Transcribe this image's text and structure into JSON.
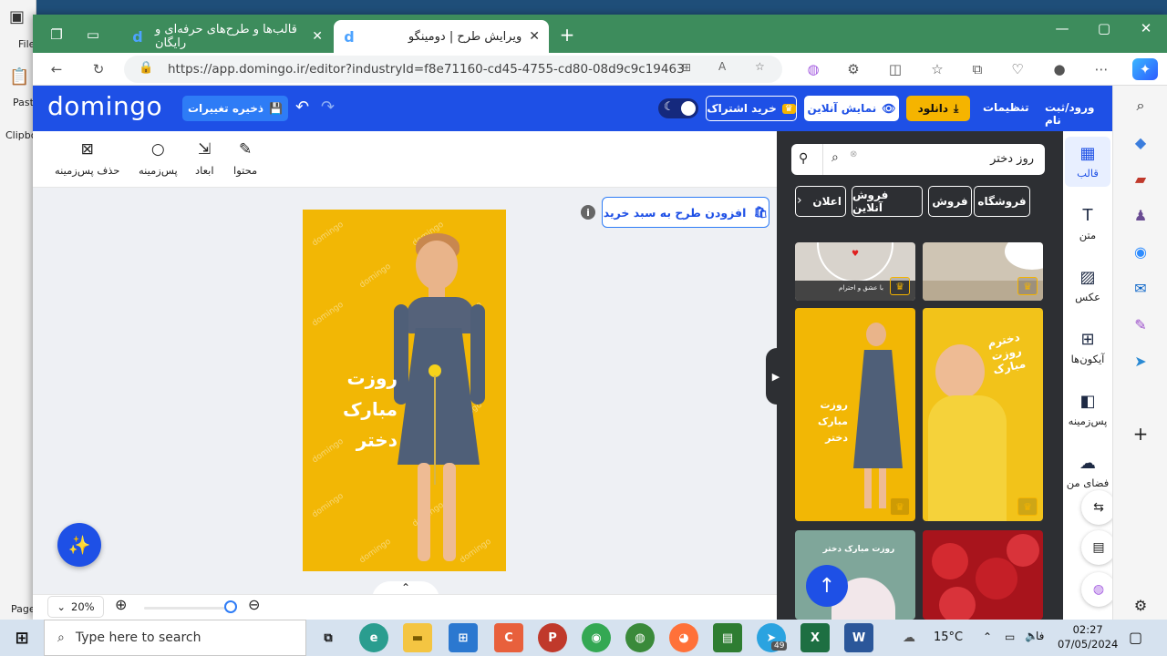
{
  "background_app": {
    "labels": [
      "File",
      "Paste",
      "Clipbo",
      "Page"
    ]
  },
  "browser": {
    "tabs": [
      {
        "label": "قالب‌ها و طرح‌های حرفه‌ای و رایگان"
      },
      {
        "label": "ویرایش طرح | دومینگو"
      }
    ],
    "url": "https://app.domingo.ir/editor?industryId=f8e71160-cd45-4755-cd80-08d9c9c19463"
  },
  "app": {
    "logo": "domingo",
    "save_label": "ذخیره تغییرات",
    "subscribe_label": "خرید اشتراک",
    "live_label": "نمایش آنلاین",
    "download_label": "دانلود",
    "settings_label": "تنظیمات",
    "login_label": "ورود/ثبت نام",
    "tools": [
      {
        "label": "حذف پس‌زمینه",
        "icon": "remove-bg-icon"
      },
      {
        "label": "پس‌زمینه",
        "icon": "background-circle-icon"
      },
      {
        "label": "ابعاد",
        "icon": "resize-icon"
      },
      {
        "label": "محتوا",
        "icon": "edit-pencil-icon"
      }
    ],
    "add_to_cart_label": "افزودن طرح به سبد خرید",
    "design": {
      "watermark": "domingo",
      "headline_line1": "روزت مبارک",
      "headline_line2": "دختر"
    },
    "zoom": "20%",
    "zoom_level_fraction": 0.9,
    "search_value": "روز دختر",
    "chips": [
      "فروشگاه",
      "فروش",
      "فروش آنلاین",
      "اعلان"
    ],
    "categories": [
      {
        "label": "قالب",
        "icon": "template-icon"
      },
      {
        "label": "متن",
        "icon": "text-icon"
      },
      {
        "label": "عکس",
        "icon": "image-icon"
      },
      {
        "label": "آیکون‌ها",
        "icon": "icons-grid-icon"
      },
      {
        "label": "پس‌زمینه",
        "icon": "background-icon"
      },
      {
        "label": "فضای من",
        "icon": "cloud-upload-icon"
      }
    ],
    "thumb_texts": {
      "t1": "با عشق و احترام",
      "t3a": "روزت مبارک",
      "t3b": "دختر",
      "t4": "دخترم روزت مبارک",
      "t5": "روزت مبارک دختر"
    }
  },
  "taskbar": {
    "search_placeholder": "Type here to search",
    "weather": "15°C",
    "lang": "فا",
    "time": "02:27",
    "date": "07/05/2024",
    "telegram_badge": "49"
  },
  "colors": {
    "brand_blue": "#1e50e6",
    "accent_yellow": "#f5b400",
    "panel_dark": "#2d2f33",
    "tabbar_green": "#3d8c5c"
  }
}
